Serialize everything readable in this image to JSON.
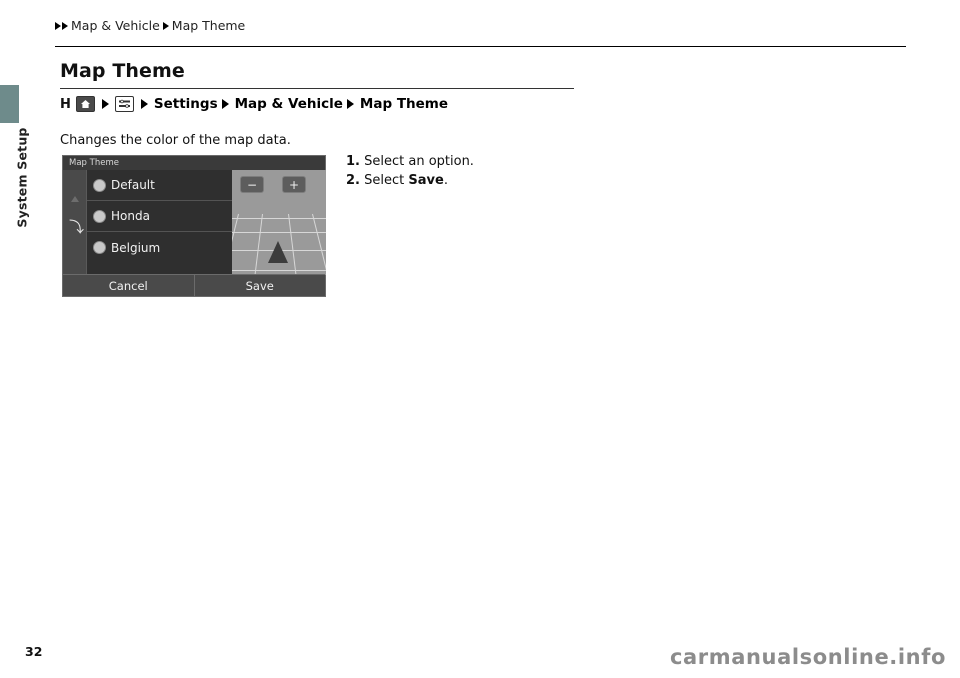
{
  "breadcrumb": {
    "items": [
      "Map & Vehicle",
      "Map Theme"
    ]
  },
  "side_tab": {
    "label": "System Setup"
  },
  "page": {
    "title": "Map Theme",
    "body_text": "Changes the color of the map data.",
    "page_number": "32",
    "watermark": "carmanualsonline.info"
  },
  "nav_path": {
    "home_glyph": "H",
    "icons": [
      "home-icon",
      "settings-menu-icon"
    ],
    "items": [
      "Settings",
      "Map & Vehicle",
      "Map Theme"
    ]
  },
  "steps": [
    {
      "num": "1.",
      "text": "Select an option.",
      "strong": ""
    },
    {
      "num": "2.",
      "text": "Select ",
      "strong": "Save",
      "tail": "."
    }
  ],
  "device": {
    "title": "Map Theme",
    "options": [
      {
        "label": "Default",
        "selected": false
      },
      {
        "label": "Honda",
        "selected": false
      },
      {
        "label": "Belgium",
        "selected": false
      }
    ],
    "zoom_out": "−",
    "zoom_in": "+",
    "buttons": [
      {
        "label": "Cancel"
      },
      {
        "label": "Save"
      }
    ]
  },
  "colors": {
    "side_tab": "#6e8b8b",
    "device_bg": "#2f2f2f",
    "watermark": "#8c8c8c"
  }
}
